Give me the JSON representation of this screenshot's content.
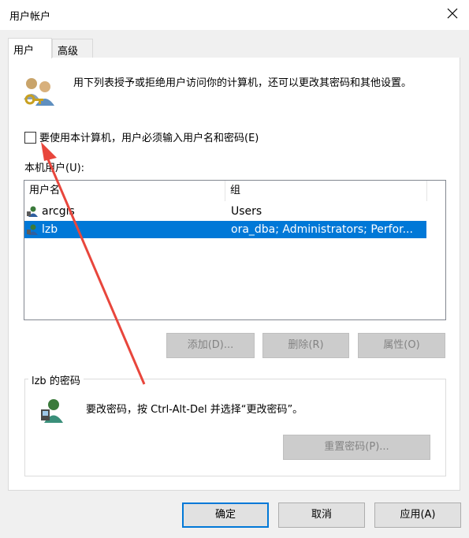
{
  "window": {
    "title": "用户帐户"
  },
  "tabs": [
    {
      "label": "用户"
    },
    {
      "label": "高级"
    }
  ],
  "description": "用下列表授予或拒绝用户访问你的计算机，还可以更改其密码和其他设置。",
  "checkbox": {
    "label": "要使用本计算机，用户必须输入用户名和密码(E)",
    "checked": false
  },
  "local_users": {
    "label": "本机用户(U):",
    "columns": [
      "用户名",
      "组"
    ],
    "rows": [
      {
        "name": "arcgis",
        "group": "Users",
        "selected": false
      },
      {
        "name": "lzb",
        "group": "ora_dba; Administrators; Perfor...",
        "selected": true
      }
    ]
  },
  "list_buttons": {
    "add": "添加(D)...",
    "remove": "删除(R)",
    "properties": "属性(O)"
  },
  "password_section": {
    "title": "lzb 的密码",
    "text": "要改密码，按 Ctrl-Alt-Del 并选择“更改密码”。",
    "reset_button": "重置密码(P)..."
  },
  "footer": {
    "ok": "确定",
    "cancel": "取消",
    "apply": "应用(A)"
  },
  "colors": {
    "selection": "#0078d7",
    "annotation_arrow": "#e8463c"
  },
  "icons": [
    "users-keys-icon",
    "user-icon",
    "user-password-icon",
    "close-icon"
  ]
}
